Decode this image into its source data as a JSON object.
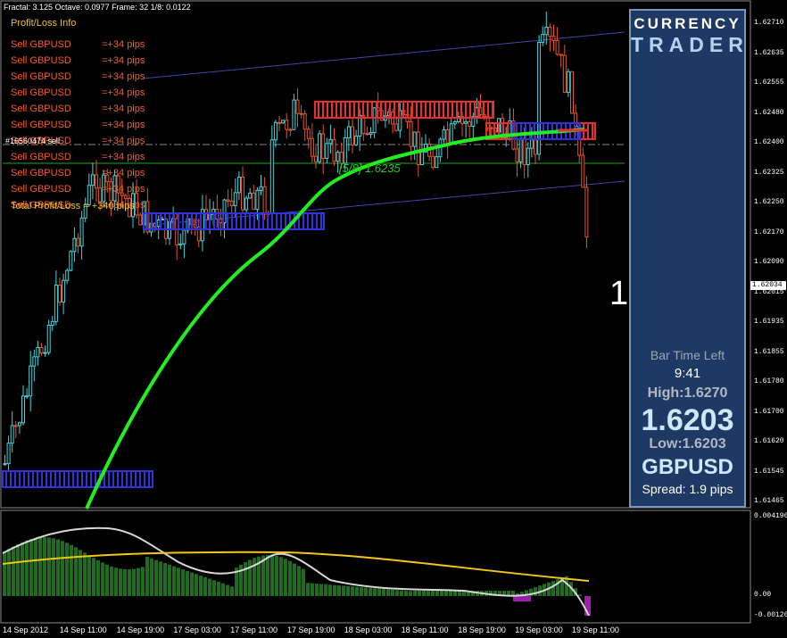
{
  "header": {
    "text": "Fractal: 3.125   Octave: 0.0977   Frame: 32   1/8: 0.0122"
  },
  "profit_loss": {
    "title": "Profit/Loss Info",
    "rows": [
      {
        "label": "Sell GBPUSD",
        "value": "=+34 pips"
      },
      {
        "label": "Sell GBPUSD",
        "value": "=+34 pips"
      },
      {
        "label": "Sell GBPUSD",
        "value": "=+34 pips"
      },
      {
        "label": "Sell GBPUSD",
        "value": "=+34 pips"
      },
      {
        "label": "Sell GBPUSD",
        "value": "=+34 pips"
      },
      {
        "label": "Sell GBPUSD",
        "value": "=+34 pips"
      },
      {
        "label": "Sell GBPUSD",
        "value": "=+34 pips"
      },
      {
        "label": "Sell GBPUSD",
        "value": "=+34 pips"
      },
      {
        "label": "Sell GBPUSD",
        "value": "=+34 pips"
      },
      {
        "label": "Sell GBPUSD",
        "value": "=+34 pips"
      },
      {
        "label": "Sell GBPUSD",
        "value": "=+34 pips"
      }
    ],
    "total": "Total Profit/Loss = +340 pips"
  },
  "overlay_label": "#16560474 sell",
  "fib_label": "[5/8] 1.6235",
  "bar_number": "1",
  "panel": {
    "brand_line1": "CURRENCY",
    "brand_line2": "TRADER",
    "bar_time_left_label": "Bar Time Left",
    "bar_time_left_value": "9:41",
    "high": "High:1.6270",
    "price": "1.6203",
    "low": "Low:1.6203",
    "symbol": "GBPUSD",
    "spread": "Spread: 1.9 pips"
  },
  "price_axis": {
    "labels": [
      "1.62710",
      "1.62635",
      "1.62555",
      "1.62480",
      "1.62400",
      "1.62325",
      "1.62250",
      "1.62170",
      "1.62090",
      "1.62015",
      "1.61935",
      "1.61855",
      "1.61780",
      "1.61700",
      "1.61620",
      "1.61545",
      "1.61465"
    ],
    "current": "1.62034"
  },
  "indicator_axis": {
    "labels": [
      "0.004196",
      "0.00",
      "-0.00126"
    ]
  },
  "time_axis": {
    "labels": [
      "14 Sep 2012",
      "14 Sep 11:00",
      "14 Sep 19:00",
      "17 Sep 03:00",
      "17 Sep 11:00",
      "17 Sep 19:00",
      "18 Sep 03:00",
      "18 Sep 11:00",
      "18 Sep 19:00",
      "19 Sep 03:00",
      "19 Sep 11:00"
    ]
  },
  "colors": {
    "bull": "#3fd6e0",
    "bear": "#e8542a",
    "ma": "#22ee22",
    "box_blue": "#3232d6",
    "box_red": "#e83030",
    "hist": "#1f6b1f",
    "signal": "#f5c518"
  }
}
